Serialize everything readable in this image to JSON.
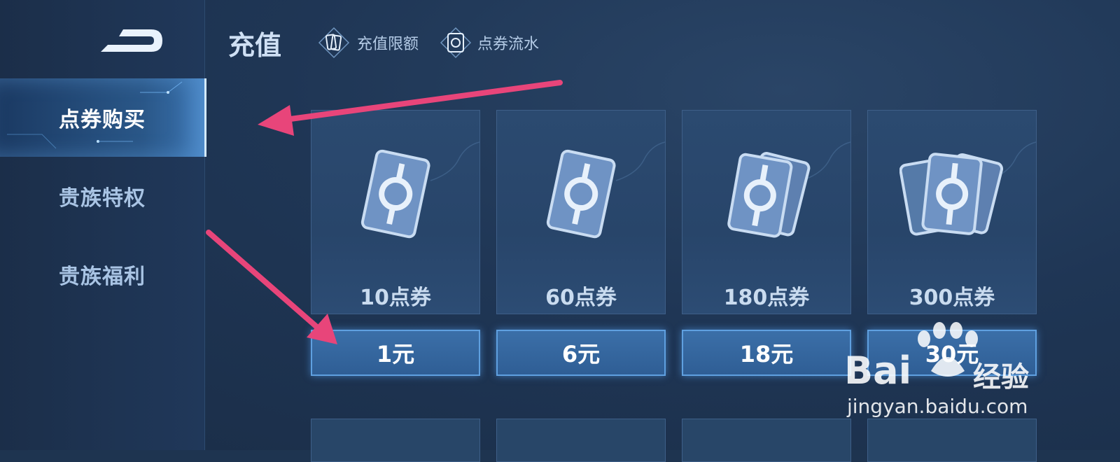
{
  "header": {
    "title": "充值",
    "links": [
      {
        "label": "充值限额",
        "icon": "card-icon"
      },
      {
        "label": "点券流水",
        "icon": "coupon-icon"
      }
    ]
  },
  "sidebar": {
    "items": [
      {
        "label": "点券购买",
        "active": true
      },
      {
        "label": "贵族特权",
        "active": false
      },
      {
        "label": "贵族福利",
        "active": false
      }
    ]
  },
  "products": [
    {
      "amount": "10点券",
      "price": "1元"
    },
    {
      "amount": "60点券",
      "price": "6元"
    },
    {
      "amount": "180点券",
      "price": "18元"
    },
    {
      "amount": "300点券",
      "price": "30元"
    }
  ],
  "watermark": {
    "brand_left": "Bai",
    "brand_right": "经验",
    "url": "jingyan.baidu.com"
  },
  "colors": {
    "accent_arrow": "#e8457a",
    "button_border": "#5fa0e0",
    "background": "#1e3450"
  }
}
